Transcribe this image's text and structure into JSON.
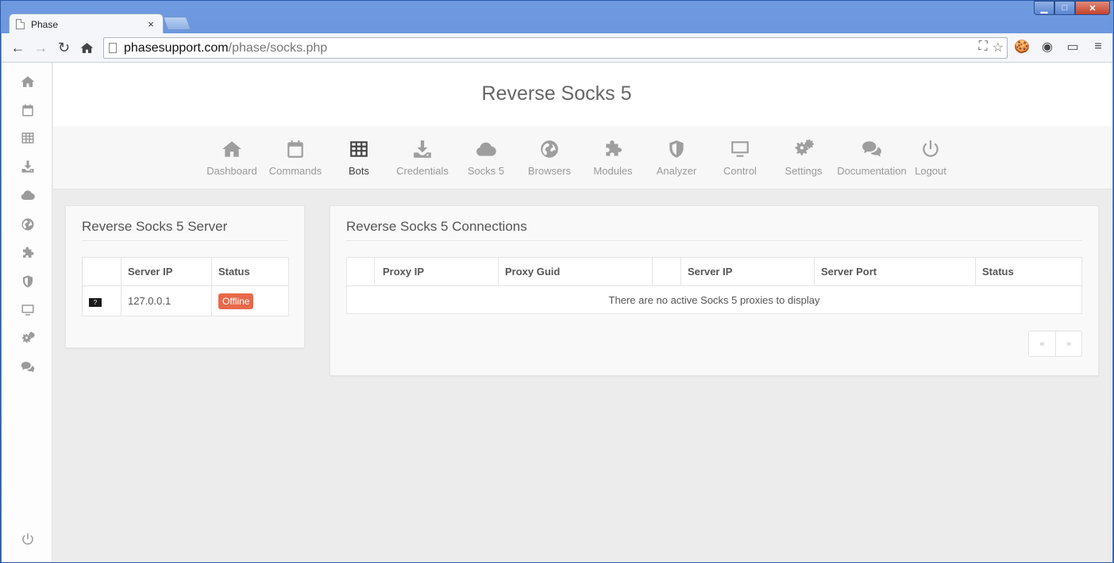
{
  "browser": {
    "tab_title": "Phase",
    "tab_close": "×",
    "url_host": "phasesupport.com",
    "url_path": "/phase/socks.php",
    "window_min": "▁",
    "window_max": "□",
    "window_close": "✕"
  },
  "page": {
    "title": "Reverse Socks 5"
  },
  "nav": [
    {
      "label": "Dashboard",
      "icon": "home-icon"
    },
    {
      "label": "Commands",
      "icon": "calendar-icon"
    },
    {
      "label": "Bots",
      "icon": "table-icon"
    },
    {
      "label": "Credentials",
      "icon": "download-icon"
    },
    {
      "label": "Socks 5",
      "icon": "cloud-icon"
    },
    {
      "label": "Browsers",
      "icon": "globe-icon"
    },
    {
      "label": "Modules",
      "icon": "puzzle-icon"
    },
    {
      "label": "Analyzer",
      "icon": "shield-icon"
    },
    {
      "label": "Control",
      "icon": "monitor-icon"
    },
    {
      "label": "Settings",
      "icon": "gears-icon"
    },
    {
      "label": "Documentation",
      "icon": "comments-icon"
    },
    {
      "label": "Logout",
      "icon": "power-icon"
    }
  ],
  "server_panel": {
    "title": "Reverse Socks 5 Server",
    "columns": [
      "",
      "Server IP",
      "Status"
    ],
    "rows": [
      {
        "icon": "?",
        "server_ip": "127.0.0.1",
        "status": "Offline"
      }
    ]
  },
  "connections_panel": {
    "title": "Reverse Socks 5 Connections",
    "columns": [
      "",
      "Proxy IP",
      "Proxy Guid",
      "",
      "Server IP",
      "Server Port",
      "Status"
    ],
    "empty_message": "There are no active Socks 5 proxies to display",
    "pager": {
      "prev": "«",
      "next": "»"
    }
  },
  "colors": {
    "offline_badge": "#e8694a",
    "active_nav": "#444444",
    "inactive_nav": "#9e9e9e"
  }
}
